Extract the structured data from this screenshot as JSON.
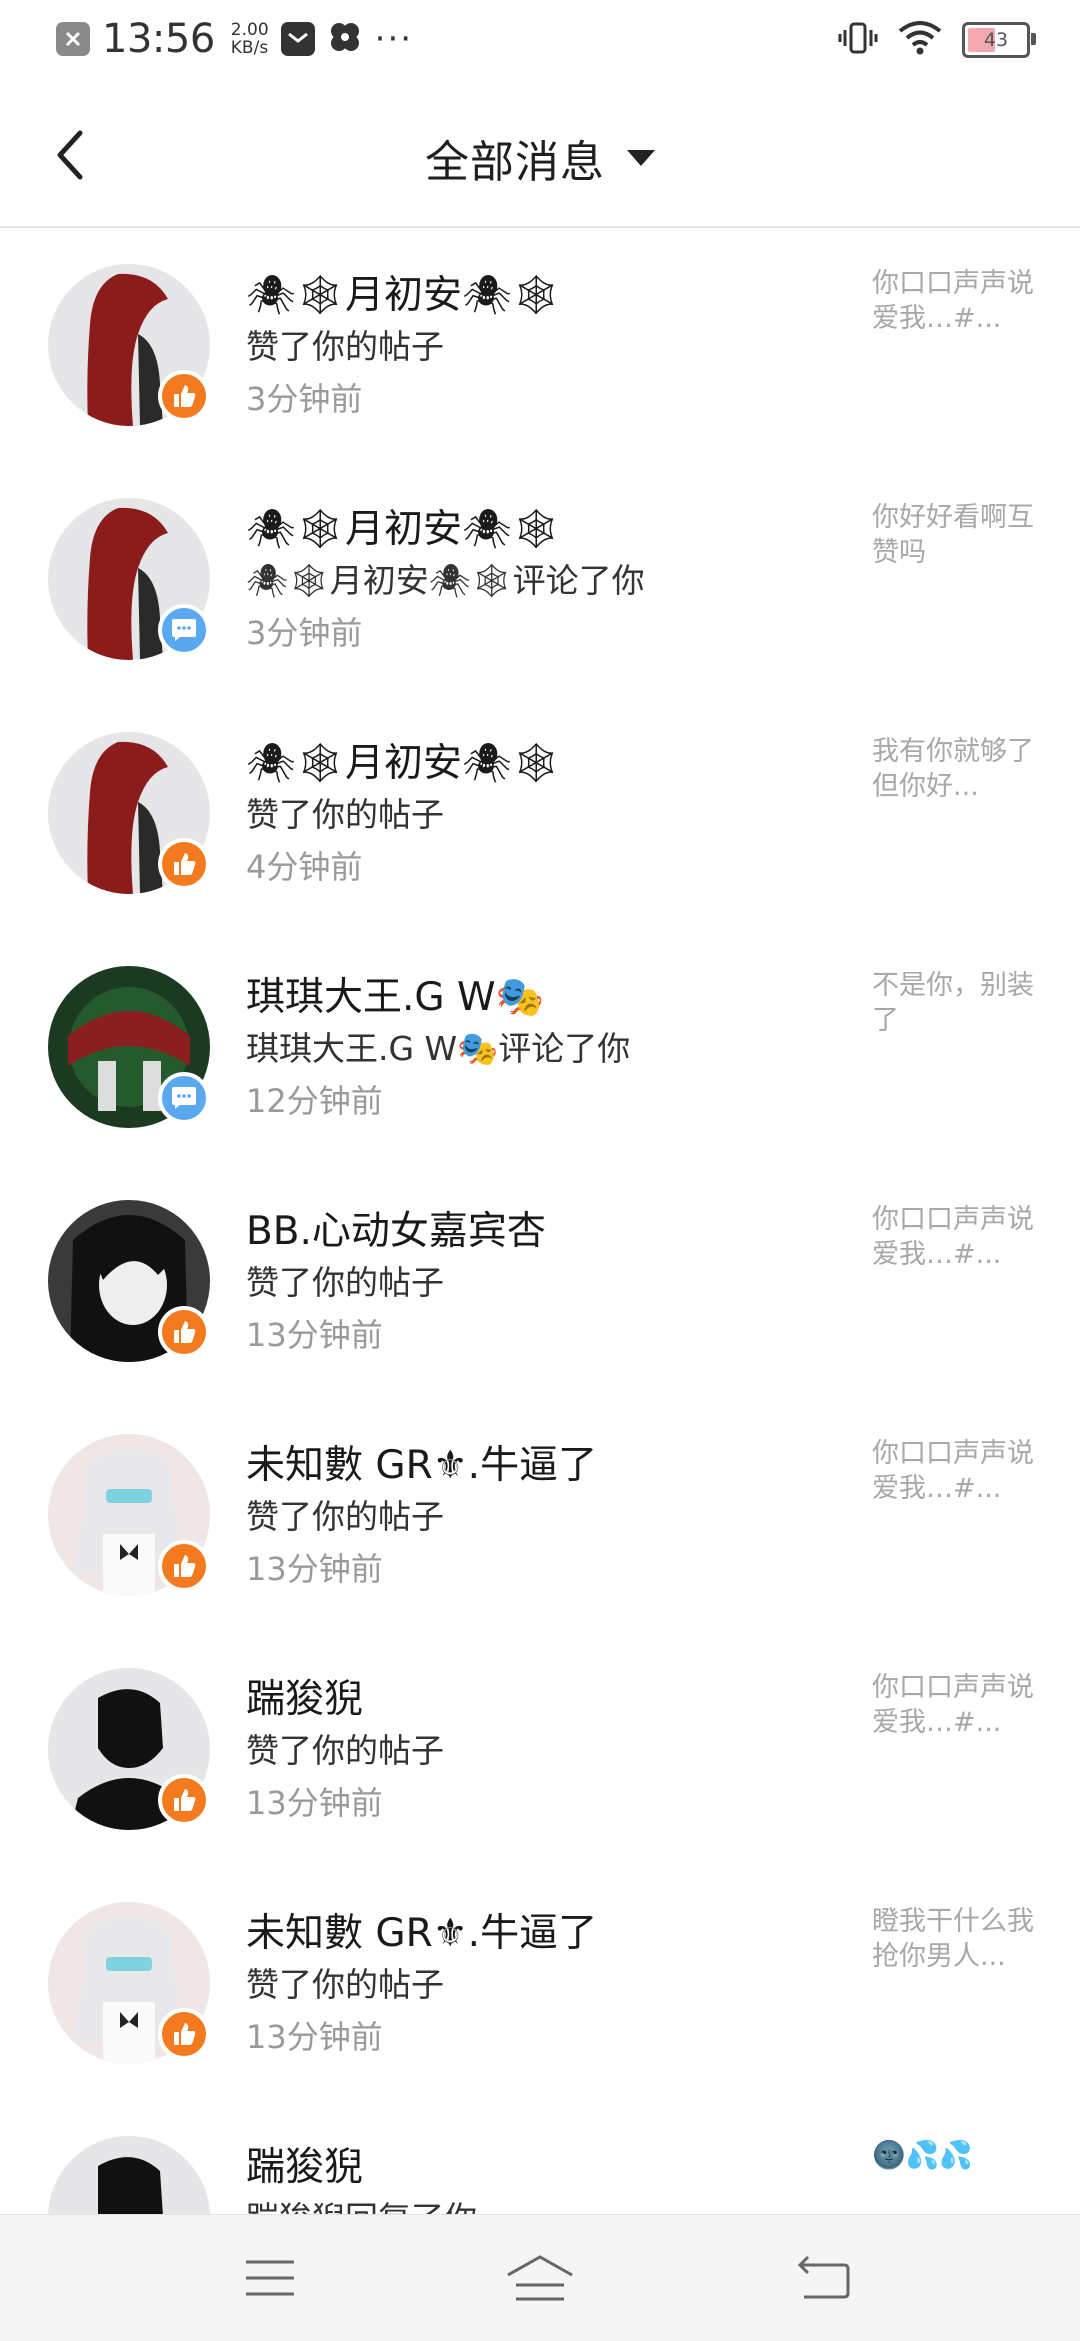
{
  "status_bar": {
    "time": "13:56",
    "speed_value": "2.00",
    "speed_unit": "KB/s",
    "more": "···",
    "battery": "43"
  },
  "header": {
    "title": "全部消息"
  },
  "messages": [
    {
      "name": "🕷🕸月初安🕷🕸",
      "action": "赞了你的帖子",
      "time": "3分钟前",
      "preview": "你口口声声说爱我…#...",
      "type": "like"
    },
    {
      "name": "🕷🕸月初安🕷🕸",
      "action": "🕷🕸月初安🕷🕸评论了你",
      "time": "3分钟前",
      "preview": "你好好看啊互赞吗",
      "type": "comment"
    },
    {
      "name": "🕷🕸月初安🕷🕸",
      "action": "赞了你的帖子",
      "time": "4分钟前",
      "preview": "我有你就够了 但你好...",
      "type": "like"
    },
    {
      "name": "琪琪大王.G W🎭",
      "action": "琪琪大王.G W🎭评论了你",
      "time": "12分钟前",
      "preview": "不是你，别装了",
      "type": "comment"
    },
    {
      "name": "BB.心动女嘉宾杏",
      "action": "赞了你的帖子",
      "time": "13分钟前",
      "preview": "你口口声声说爱我…#...",
      "type": "like"
    },
    {
      "name": "未知數 GR⚜.牛逼了",
      "action": "赞了你的帖子",
      "time": "13分钟前",
      "preview": "你口口声声说爱我…#...",
      "type": "like"
    },
    {
      "name": "踹狻猊",
      "action": "赞了你的帖子",
      "time": "13分钟前",
      "preview": "你口口声声说爱我…#...",
      "type": "like"
    },
    {
      "name": "未知數 GR⚜.牛逼了",
      "action": "赞了你的帖子",
      "time": "13分钟前",
      "preview": "瞪我干什么我抢你男人...",
      "type": "like"
    },
    {
      "name": "踹狻猊",
      "action": "踹狻猊回复了你",
      "time": "",
      "preview": "🌚💦💦",
      "type": "comment"
    }
  ],
  "colors": {
    "like_badge": "#f47a1f",
    "comment_badge": "#5aa8ef"
  }
}
